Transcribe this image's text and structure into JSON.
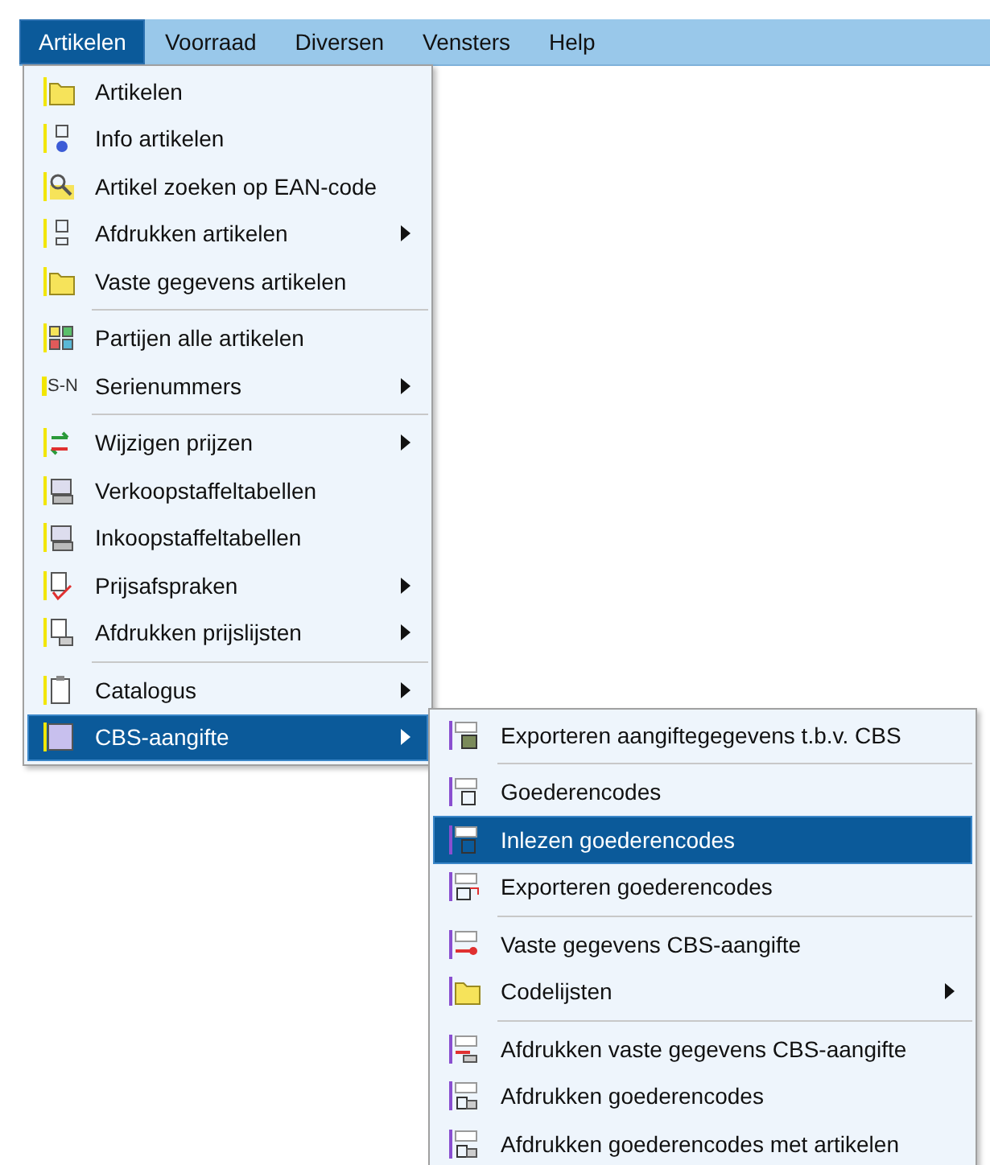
{
  "menu_bar": [
    {
      "label": "Artikelen",
      "selected": true
    },
    {
      "label": "Voorraad",
      "selected": false
    },
    {
      "label": "Diversen",
      "selected": false
    },
    {
      "label": "Vensters",
      "selected": false
    },
    {
      "label": "Help",
      "selected": false
    }
  ],
  "menu": {
    "items": [
      {
        "kind": "item",
        "label": "Artikelen",
        "submenu": false,
        "selected": false
      },
      {
        "kind": "item",
        "label": "Info artikelen",
        "submenu": false,
        "selected": false
      },
      {
        "kind": "item",
        "label": "Artikel zoeken op EAN-code",
        "submenu": false,
        "selected": false
      },
      {
        "kind": "item",
        "label": "Afdrukken artikelen",
        "submenu": true,
        "selected": false
      },
      {
        "kind": "item",
        "label": "Vaste gegevens artikelen",
        "submenu": false,
        "selected": false
      },
      {
        "kind": "separator"
      },
      {
        "kind": "item",
        "label": "Partijen alle artikelen",
        "submenu": false,
        "selected": false
      },
      {
        "kind": "item",
        "label": "Serienummers",
        "submenu": true,
        "selected": false,
        "icon_label": "S-N"
      },
      {
        "kind": "separator"
      },
      {
        "kind": "item",
        "label": "Wijzigen prijzen",
        "submenu": true,
        "selected": false
      },
      {
        "kind": "item",
        "label": "Verkoopstaffeltabellen",
        "submenu": false,
        "selected": false
      },
      {
        "kind": "item",
        "label": "Inkoopstaffeltabellen",
        "submenu": false,
        "selected": false
      },
      {
        "kind": "item",
        "label": "Prijsafspraken",
        "submenu": true,
        "selected": false
      },
      {
        "kind": "item",
        "label": "Afdrukken prijslijsten",
        "submenu": true,
        "selected": false
      },
      {
        "kind": "separator"
      },
      {
        "kind": "item",
        "label": "Catalogus",
        "submenu": true,
        "selected": false
      },
      {
        "kind": "item",
        "label": "CBS-aangifte",
        "submenu": true,
        "selected": true
      }
    ]
  },
  "submenu": {
    "items": [
      {
        "kind": "item",
        "label": "Exporteren aangiftegegevens t.b.v. CBS",
        "submenu": false,
        "selected": false
      },
      {
        "kind": "separator"
      },
      {
        "kind": "item",
        "label": "Goederencodes",
        "submenu": false,
        "selected": false
      },
      {
        "kind": "item",
        "label": "Inlezen goederencodes",
        "submenu": false,
        "selected": true
      },
      {
        "kind": "item",
        "label": "Exporteren goederencodes",
        "submenu": false,
        "selected": false
      },
      {
        "kind": "separator"
      },
      {
        "kind": "item",
        "label": "Vaste gegevens CBS-aangifte",
        "submenu": false,
        "selected": false
      },
      {
        "kind": "item",
        "label": "Codelijsten",
        "submenu": true,
        "selected": false
      },
      {
        "kind": "separator"
      },
      {
        "kind": "item",
        "label": "Afdrukken vaste gegevens CBS-aangifte",
        "submenu": false,
        "selected": false
      },
      {
        "kind": "item",
        "label": "Afdrukken goederencodes",
        "submenu": false,
        "selected": false
      },
      {
        "kind": "item",
        "label": "Afdrukken goederencodes met artikelen",
        "submenu": false,
        "selected": false
      }
    ]
  }
}
